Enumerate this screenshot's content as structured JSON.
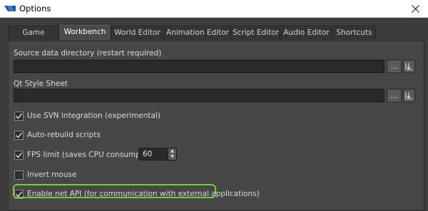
{
  "window": {
    "title": "Options"
  },
  "tabs": [
    {
      "label": "Game Project"
    },
    {
      "label": "Workbench"
    },
    {
      "label": "World Editor"
    },
    {
      "label": "Animation Editor"
    },
    {
      "label": "Script Editor"
    },
    {
      "label": "Audio Editor"
    },
    {
      "label": "Shortcuts"
    }
  ],
  "active_tab": "Workbench",
  "workbench": {
    "source_dir": {
      "label": "Source data directory (restart required)",
      "value": "",
      "browse_label": "...",
      "icon": "arrow-icon"
    },
    "qt_style": {
      "label": "Qt Style Sheet",
      "value": "",
      "browse_label": "...",
      "icon": "arrow-icon"
    },
    "options": [
      {
        "label": "Use SVN integration (experimental)",
        "checked": true
      },
      {
        "label": "Auto-rebuild scripts",
        "checked": true
      },
      {
        "label": "FPS limit (saves CPU consumption)",
        "checked": true,
        "value": "60"
      },
      {
        "label": "Invert mouse",
        "checked": false
      },
      {
        "label": "Enable net API (for communication with external applications)",
        "checked": true,
        "highlighted": true
      }
    ]
  },
  "colors": {
    "highlight": "#6bd13a",
    "background": "#474747",
    "input": "#2a2a2a"
  }
}
